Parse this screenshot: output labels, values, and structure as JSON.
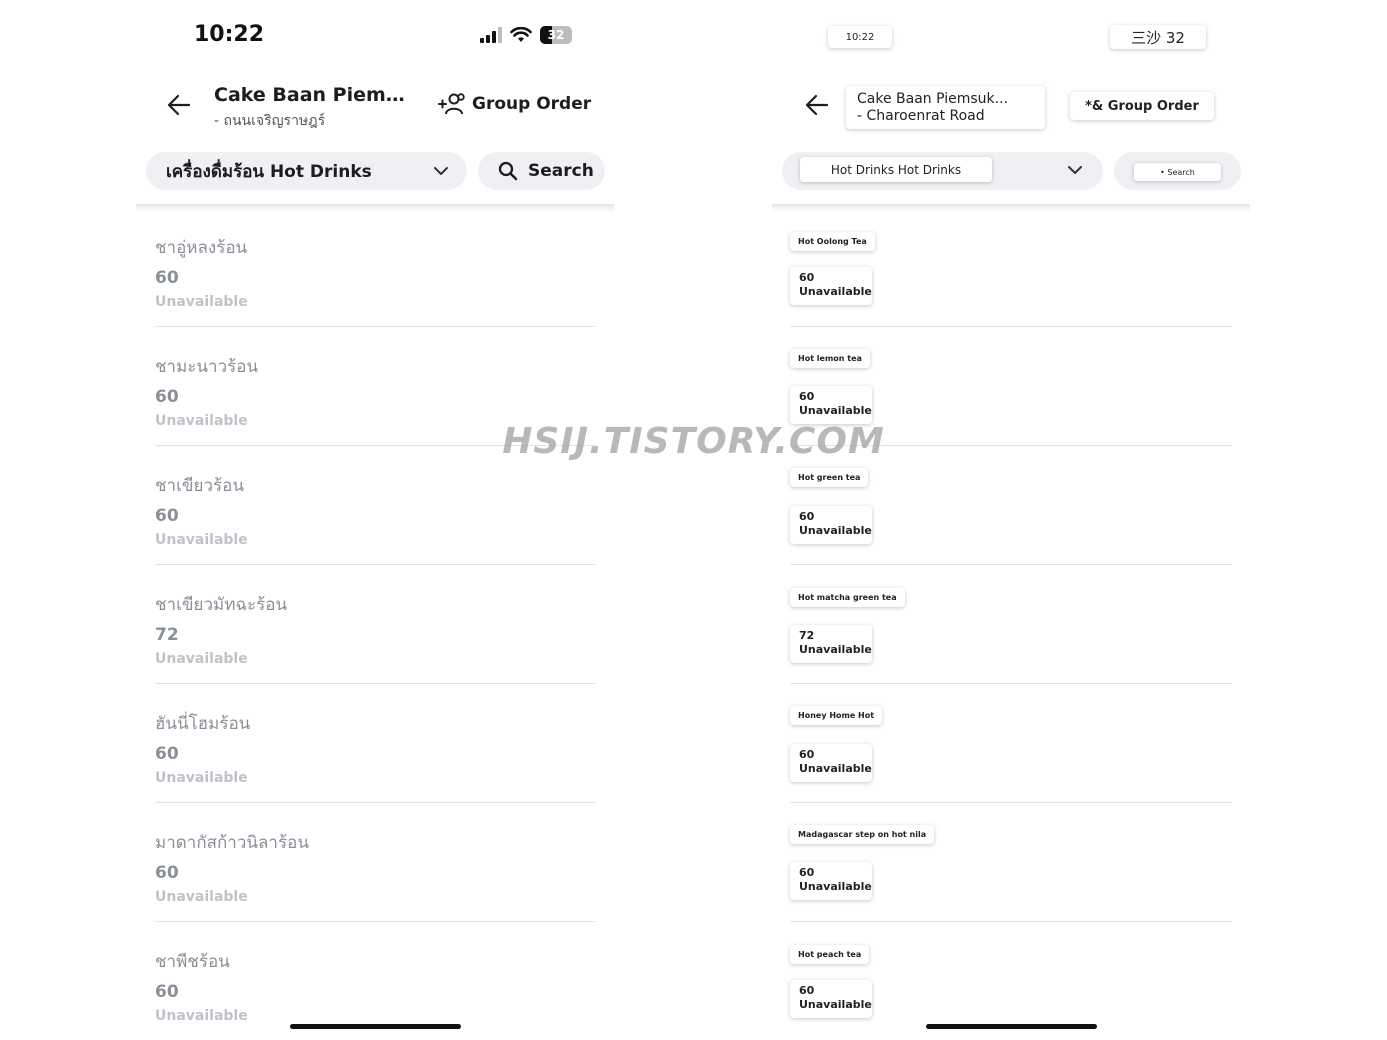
{
  "left_screen": {
    "status": {
      "time": "10:22",
      "battery": "32"
    },
    "header": {
      "store_name": "Cake Baan Piemsuk...",
      "store_sub": "- ถนนเจริญราษฎร์",
      "group_order": "Group Order"
    },
    "category": {
      "label": "เครื่องดื่มร้อน Hot Drinks"
    },
    "search": {
      "label": "Search"
    },
    "items": [
      {
        "name": "ชาอู่หลงร้อน",
        "price": "60",
        "status": "Unavailable"
      },
      {
        "name": "ชามะนาวร้อน",
        "price": "60",
        "status": "Unavailable"
      },
      {
        "name": "ชาเขียวร้อน",
        "price": "60",
        "status": "Unavailable"
      },
      {
        "name": "ชาเขียวมัทฉะร้อน",
        "price": "72",
        "status": "Unavailable"
      },
      {
        "name": "ฮันนี่โฮมร้อน",
        "price": "60",
        "status": "Unavailable"
      },
      {
        "name": "มาดากัสก้าวนิลาร้อน",
        "price": "60",
        "status": "Unavailable"
      },
      {
        "name": "ชาพีชร้อน",
        "price": "60",
        "status": "Unavailable"
      }
    ]
  },
  "right_screen": {
    "status": {
      "time": "10:22",
      "battery": "三沙 32"
    },
    "header": {
      "store_name_line1": "Cake Baan Piemsuk...",
      "store_name_line2": "- Charoenrat Road",
      "group_order": "*& Group Order"
    },
    "category": {
      "label": "Hot Drinks Hot Drinks"
    },
    "search": {
      "label": "• Search"
    },
    "items": [
      {
        "name": "Hot Oolong Tea",
        "price": "60",
        "status": "Unavailable"
      },
      {
        "name": "Hot lemon tea",
        "price": "60",
        "status": "Unavailable"
      },
      {
        "name": "Hot green tea",
        "price": "60",
        "status": "Unavailable"
      },
      {
        "name": "Hot matcha green tea",
        "price": "72",
        "status": "Unavailable"
      },
      {
        "name": "Honey Home Hot",
        "price": "60",
        "status": "Unavailable"
      },
      {
        "name": "Madagascar step on hot nila",
        "price": "60",
        "status": "Unavailable"
      },
      {
        "name": "Hot peach tea",
        "price": "60",
        "status": "Unavailable"
      }
    ]
  },
  "watermark": "HSIJ.TISTORY.COM"
}
